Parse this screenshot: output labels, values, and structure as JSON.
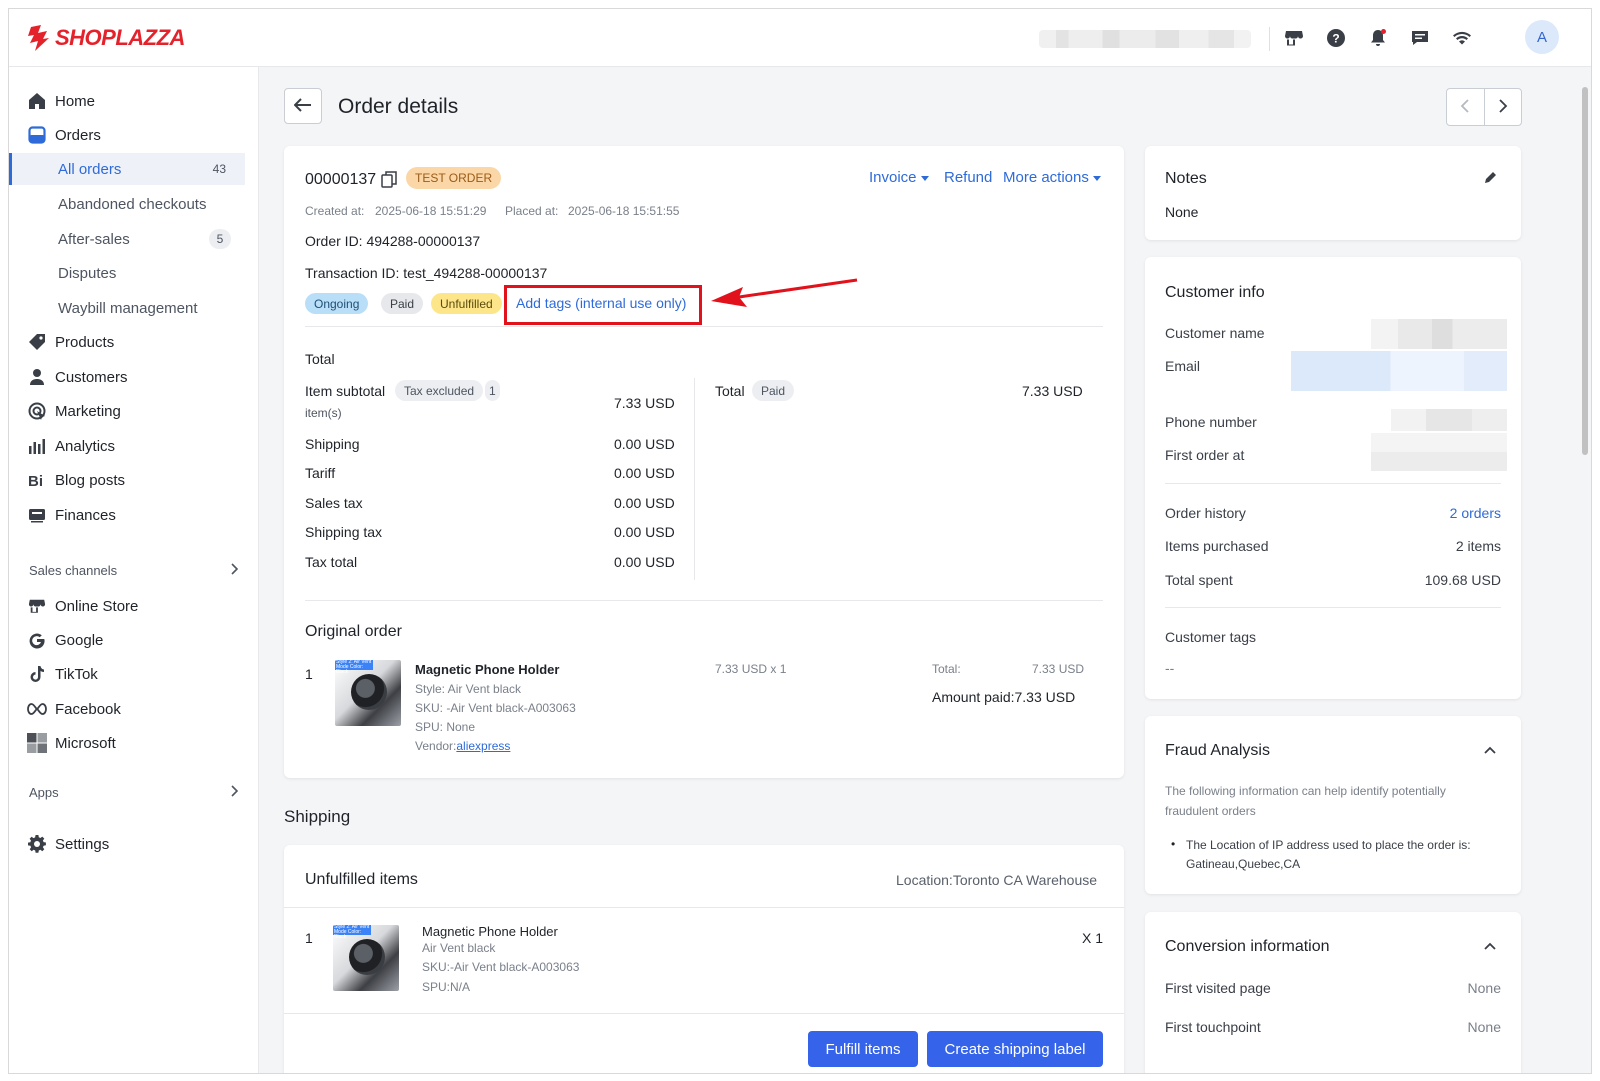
{
  "brand": {
    "name": "SHOPLAZZA",
    "color": "#e4222c",
    "accent": "#2f6bd8"
  },
  "topbar": {
    "icons": [
      "store-icon",
      "help-icon",
      "bell-icon",
      "chat-icon",
      "wifi-icon"
    ],
    "avatar_letter": "A"
  },
  "sidebar": {
    "home": "Home",
    "orders": "Orders",
    "orders_sub": [
      {
        "label": "All orders",
        "count": "43"
      },
      {
        "label": "Abandoned checkouts",
        "count": ""
      },
      {
        "label": "After-sales",
        "count": "5"
      },
      {
        "label": "Disputes",
        "count": ""
      },
      {
        "label": "Waybill management",
        "count": ""
      }
    ],
    "products": "Products",
    "customers": "Customers",
    "marketing": "Marketing",
    "analytics": "Analytics",
    "blog_posts": "Blog posts",
    "finances": "Finances",
    "sales_channels": "Sales channels",
    "channels": [
      "Online Store",
      "Google",
      "TikTok",
      "Facebook",
      "Microsoft"
    ],
    "apps": "Apps",
    "settings": "Settings"
  },
  "page": {
    "title": "Order details"
  },
  "order": {
    "number": "00000137",
    "test_badge": "TEST ORDER",
    "actions": {
      "invoice": "Invoice",
      "refund": "Refund",
      "more": "More actions"
    },
    "created_label": "Created at:",
    "created_value": "2025-06-18 15:51:29",
    "placed_label": "Placed at:",
    "placed_value": "2025-06-18 15:51:55",
    "order_id": "Order ID: 494288-00000137",
    "transaction_id": "Transaction ID: test_494288-00000137",
    "status_tags": {
      "ongoing": "Ongoing",
      "paid": "Paid",
      "unfulfilled": "Unfulfilled"
    },
    "add_tags": "Add tags (internal use only)"
  },
  "totals": {
    "heading": "Total",
    "item_subtotal": "Item subtotal",
    "tax_excluded": "Tax excluded",
    "item_count": "1",
    "items_unit": "item(s)",
    "item_subtotal_value": "7.33 USD",
    "rows": [
      {
        "label": "Shipping",
        "value": "0.00 USD"
      },
      {
        "label": "Tariff",
        "value": "0.00 USD"
      },
      {
        "label": "Sales tax",
        "value": "0.00 USD"
      },
      {
        "label": "Shipping tax",
        "value": "0.00 USD"
      },
      {
        "label": "Tax total",
        "value": "0.00 USD"
      }
    ],
    "total_label": "Total",
    "total_status": "Paid",
    "total_value": "7.33 USD"
  },
  "original_order": {
    "heading": "Original order",
    "qty": "1",
    "thumb_banner": "Style 2: Air Vent Mode Color: Black",
    "product_name": "Magnetic Phone Holder",
    "style": "Style: Air Vent black",
    "sku": "SKU: -Air Vent black-A003063",
    "spu": "SPU: None",
    "vendor_label": "Vendor:",
    "vendor_link": "aliexpress",
    "unit_price": "7.33 USD x 1",
    "total_label": "Total:",
    "total_value": "7.33 USD",
    "amount_paid": "Amount paid:7.33 USD"
  },
  "shipping": {
    "heading": "Shipping",
    "unfulfilled_heading": "Unfulfilled items",
    "location": "Location:Toronto CA Warehouse",
    "qty": "1",
    "product_name": "Magnetic Phone Holder",
    "variant": "Air Vent black",
    "sku": "SKU:-Air Vent black-A003063",
    "spu": "SPU:N/A",
    "quantity": "X 1",
    "fulfill_btn": "Fulfill items",
    "label_btn": "Create shipping label"
  },
  "notes": {
    "heading": "Notes",
    "value": "None"
  },
  "customer": {
    "heading": "Customer info",
    "name_label": "Customer name",
    "email_label": "Email",
    "phone_label": "Phone number",
    "first_order_label": "First order at",
    "order_history_label": "Order history",
    "order_history_value": "2 orders",
    "items_purchased_label": "Items purchased",
    "items_purchased_value": "2 items",
    "total_spent_label": "Total spent",
    "total_spent_value": "109.68 USD",
    "tags_label": "Customer tags",
    "tags_value": "--"
  },
  "fraud": {
    "heading": "Fraud Analysis",
    "description": "The following information can help identify potentially fraudulent orders",
    "bullet_line1": "The Location of IP address used to place the order is:",
    "bullet_line2": "Gatineau,Quebec,CA"
  },
  "conversion": {
    "heading": "Conversion information",
    "first_visited_label": "First visited page",
    "first_visited_value": "None",
    "first_touch_label": "First touchpoint",
    "first_touch_value": "None"
  }
}
